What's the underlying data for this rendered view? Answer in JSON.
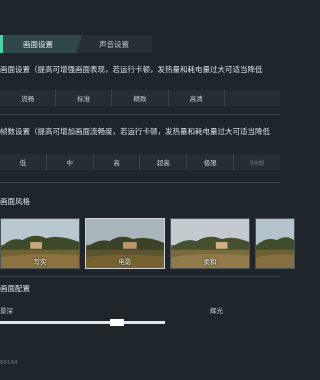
{
  "tabs": [
    {
      "label": "画面设置",
      "active": true
    },
    {
      "label": "声音设置",
      "active": false
    }
  ],
  "graphics": {
    "description": "画面设置（提高可增强画面表现，若运行卡顿，发热量和耗电量过大可适当降低",
    "options": [
      "流畅",
      "标准",
      "精致",
      "高清",
      ""
    ]
  },
  "framerate": {
    "description": "帧数设置（提高可增加画面流畅度，若运行卡顿，发热量和耗电量过大可适当降低",
    "options": [
      "低",
      "中",
      "高",
      "超高",
      "极限",
      "98帧"
    ]
  },
  "style": {
    "title": "画面风格",
    "cards": [
      {
        "label": "写实",
        "selected": false
      },
      {
        "label": "电影",
        "selected": true
      },
      {
        "label": "柔和",
        "selected": false
      },
      {
        "label": "",
        "selected": false
      }
    ]
  },
  "config": {
    "title": "画面配置",
    "depth_label": "景深",
    "glow_label": "辉光"
  },
  "footer": "88194"
}
